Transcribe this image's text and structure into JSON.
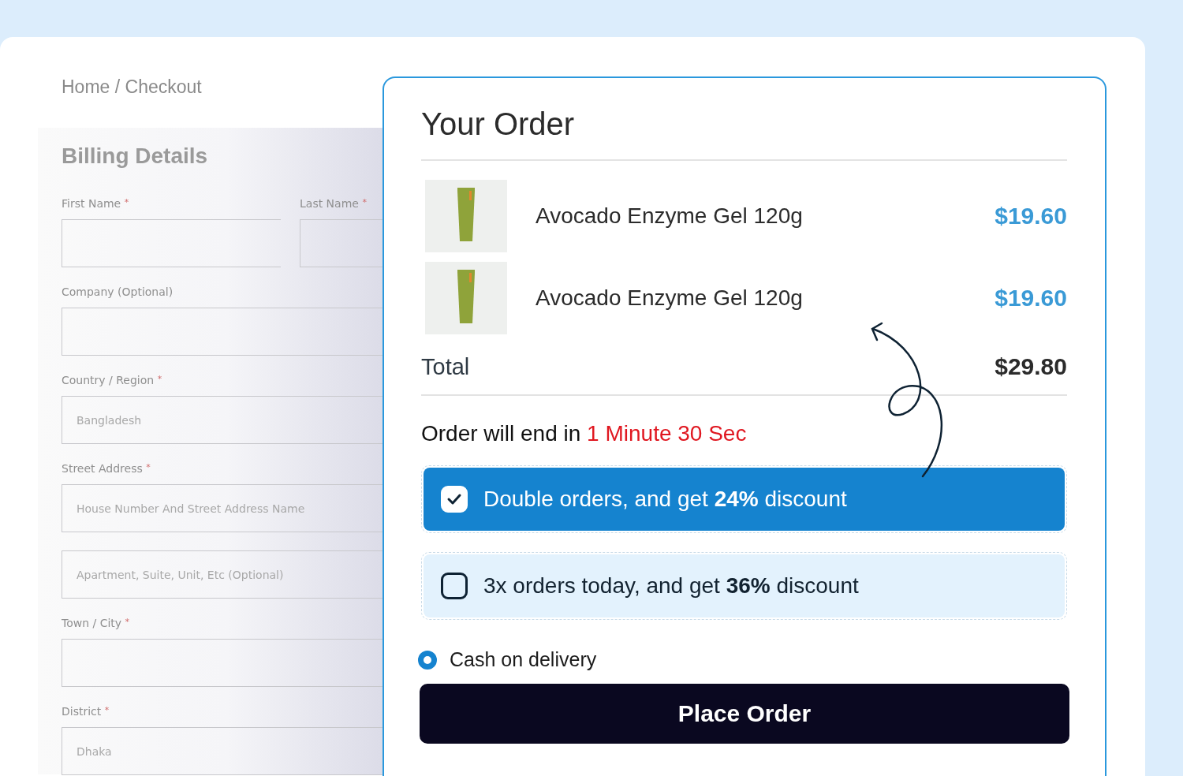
{
  "breadcrumb": "Home / Checkout",
  "billing": {
    "title": "Billing Details",
    "fields": [
      {
        "kind": "pair",
        "items": [
          {
            "label": "First Name",
            "mark": "*"
          },
          {
            "label": "Last Name",
            "mark": "*"
          }
        ]
      },
      {
        "kind": "single",
        "label": "Company (Optional)"
      },
      {
        "kind": "single",
        "label": "Country / Region",
        "mark": "*",
        "value": "Bangladesh"
      },
      {
        "kind": "single",
        "label": "Street Address",
        "mark": "*",
        "placeholder": "House Number And Street Address Name"
      },
      {
        "kind": "single",
        "placeholder": "Apartment, Suite, Unit, Etc (Optional)"
      },
      {
        "kind": "single",
        "label": "Town / City",
        "mark": "*"
      },
      {
        "kind": "single",
        "label": "District",
        "mark": "*",
        "value": "Dhaka"
      }
    ]
  },
  "order": {
    "title": "Your Order",
    "items": [
      {
        "name": "Avocado Enzyme Gel 120g",
        "price": "$19.60"
      },
      {
        "name": "Avocado Enzyme Gel 120g",
        "price": "$19.60"
      }
    ],
    "total_label": "Total",
    "total": "$29.80",
    "countdown": {
      "text": "Order will end in",
      "time": "1 Minute 30 Sec"
    },
    "offers": [
      {
        "text": "Double orders, and get **24%** discount",
        "checked": true
      },
      {
        "text": "3x orders today, and get **36%** discount",
        "checked": false
      }
    ],
    "payment": {
      "label": "Cash on delivery",
      "selected": true
    },
    "button": "Place Order"
  }
}
